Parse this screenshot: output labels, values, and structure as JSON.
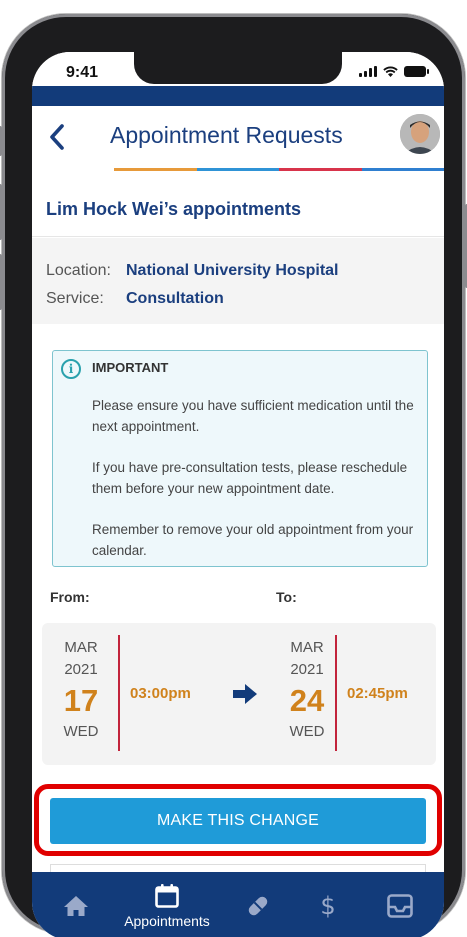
{
  "status_bar": {
    "time": "9:41"
  },
  "header": {
    "title": "Appointment Requests"
  },
  "patient": {
    "appointments_title": "Lim Hock Wei’s appointments"
  },
  "details": {
    "location_label": "Location:",
    "location_value": "National University Hospital",
    "service_label": "Service:",
    "service_value": "Consultation"
  },
  "notice": {
    "title": "IMPORTANT",
    "line1": "Please ensure you have sufficient medication until the next appointment.",
    "line2": "If you have pre-consultation tests, please reschedule them before your new appointment date.",
    "line3": "Remember to remove your old appointment from your calendar."
  },
  "change": {
    "from_label": "From:",
    "to_label": "To:",
    "from": {
      "month": "MAR",
      "year": "2021",
      "day": "17",
      "weekday": "WED",
      "time": "03:00pm"
    },
    "to": {
      "month": "MAR",
      "year": "2021",
      "day": "24",
      "weekday": "WED",
      "time": "02:45pm"
    }
  },
  "cta": {
    "label": "MAKE THIS CHANGE"
  },
  "nav": {
    "items": [
      {
        "icon": "home-icon",
        "label": ""
      },
      {
        "icon": "calendar-icon",
        "label": "Appointments"
      },
      {
        "icon": "pill-icon",
        "label": ""
      },
      {
        "icon": "dollar-icon",
        "label": "$"
      },
      {
        "icon": "inbox-icon",
        "label": ""
      }
    ]
  },
  "colors": {
    "brand_blue": "#123b7a",
    "title_blue": "#1b3f7f",
    "accent_orange": "#d0821c",
    "divider_red": "#c2243b",
    "button_blue": "#1f9bd8",
    "highlight_red": "#e00000",
    "line_segments": [
      "#e79a3a",
      "#2f93d6",
      "#d8344b",
      "#2f7fd0"
    ]
  }
}
